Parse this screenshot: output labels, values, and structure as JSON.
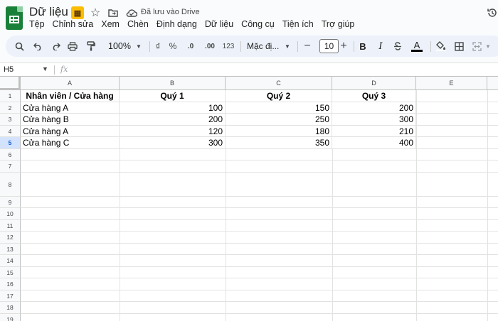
{
  "app": {
    "title": "Dữ liệu",
    "save_status": "Đã lưu vào Drive",
    "icons": [
      "sheets-logo-icon",
      "apps-script-addon-icon",
      "star-icon",
      "move-folder-icon",
      "cloud-saved-icon",
      "version-history-icon"
    ]
  },
  "menu": [
    "Tệp",
    "Chỉnh sửa",
    "Xem",
    "Chèn",
    "Định dạng",
    "Dữ liệu",
    "Công cụ",
    "Tiện ích",
    "Trợ giúp"
  ],
  "toolbar": {
    "zoom": "100%",
    "currency": "₫",
    "percent": "%",
    "decrease_decimal": ".0",
    "increase_decimal": ".00",
    "number_format": "123",
    "font": "Mặc đị...",
    "font_size": "10",
    "bold": "B",
    "italic": "I",
    "text_color": "A"
  },
  "formula_bar": {
    "cell_ref": "H5",
    "fx": "fx",
    "content": ""
  },
  "sheet": {
    "columns": [
      "A",
      "B",
      "C",
      "D",
      "E"
    ],
    "rows": [
      "1",
      "2",
      "3",
      "4",
      "5",
      "6",
      "7",
      "8",
      "9",
      "10",
      "11",
      "12",
      "13",
      "14",
      "15",
      "16",
      "17",
      "18",
      "19"
    ],
    "active_row": "5",
    "header": [
      "Nhân viên / Cửa hàng",
      "Quý 1",
      "Quý 2",
      "Quý 3"
    ],
    "data": [
      [
        "Cửa hàng A",
        "100",
        "150",
        "200"
      ],
      [
        "Cửa hàng B",
        "200",
        "250",
        "300"
      ],
      [
        "Cửa hàng A",
        "120",
        "180",
        "210"
      ],
      [
        "Cửa hàng C",
        "300",
        "350",
        "400"
      ]
    ]
  }
}
